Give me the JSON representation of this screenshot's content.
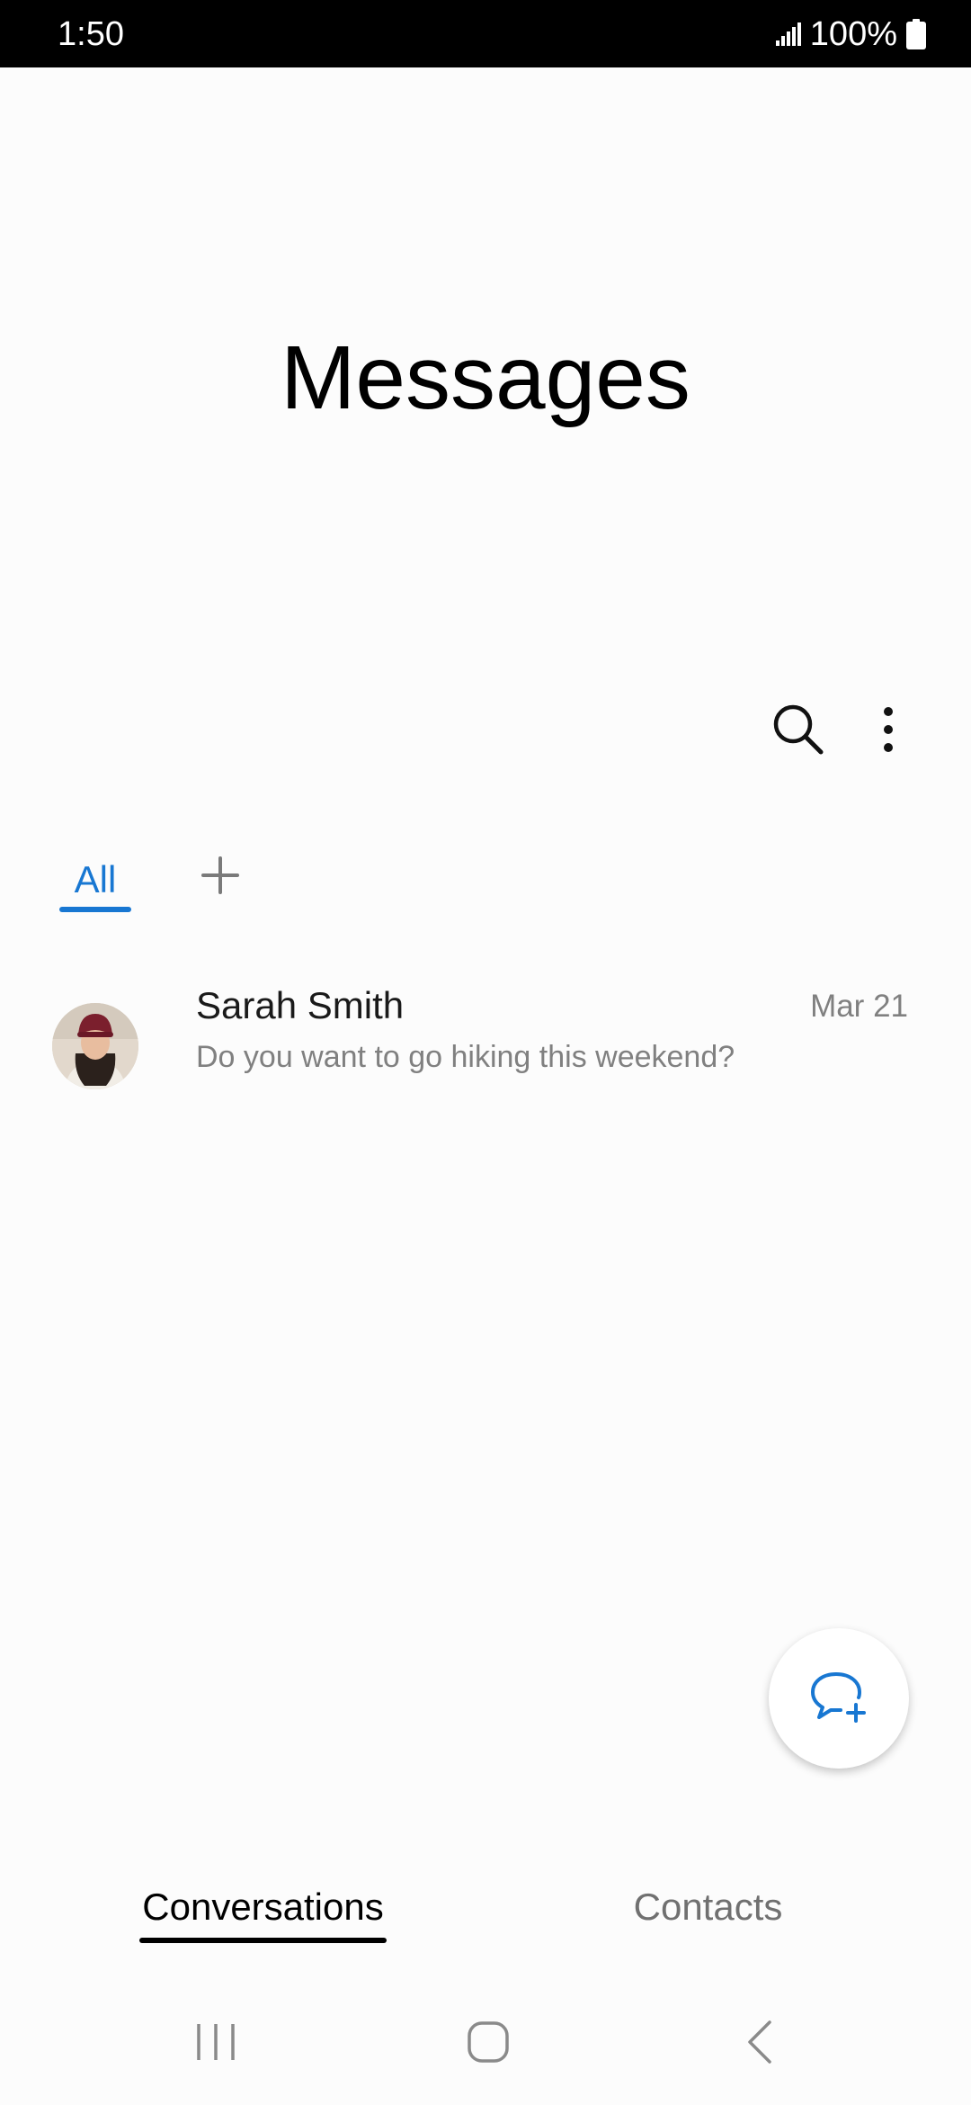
{
  "status_bar": {
    "time": "1:50",
    "battery": "100%"
  },
  "header": {
    "title": "Messages"
  },
  "toolbar": {
    "search_icon": "search-icon",
    "more_icon": "more-options-icon"
  },
  "category_tabs": {
    "all_label": "All",
    "add_icon": "plus-icon"
  },
  "conversations": [
    {
      "name": "Sarah Smith",
      "date": "Mar 21",
      "preview": "Do you want to go hiking this weekend?"
    }
  ],
  "fab": {
    "icon": "new-message-icon"
  },
  "bottom_tabs": {
    "conversations_label": "Conversations",
    "contacts_label": "Contacts"
  },
  "nav_bar": {
    "recents_icon": "recents-icon",
    "home_icon": "home-icon",
    "back_icon": "back-icon"
  },
  "colors": {
    "accent": "#1877d2",
    "background": "#fcfcfc",
    "secondary_text": "#808080"
  }
}
